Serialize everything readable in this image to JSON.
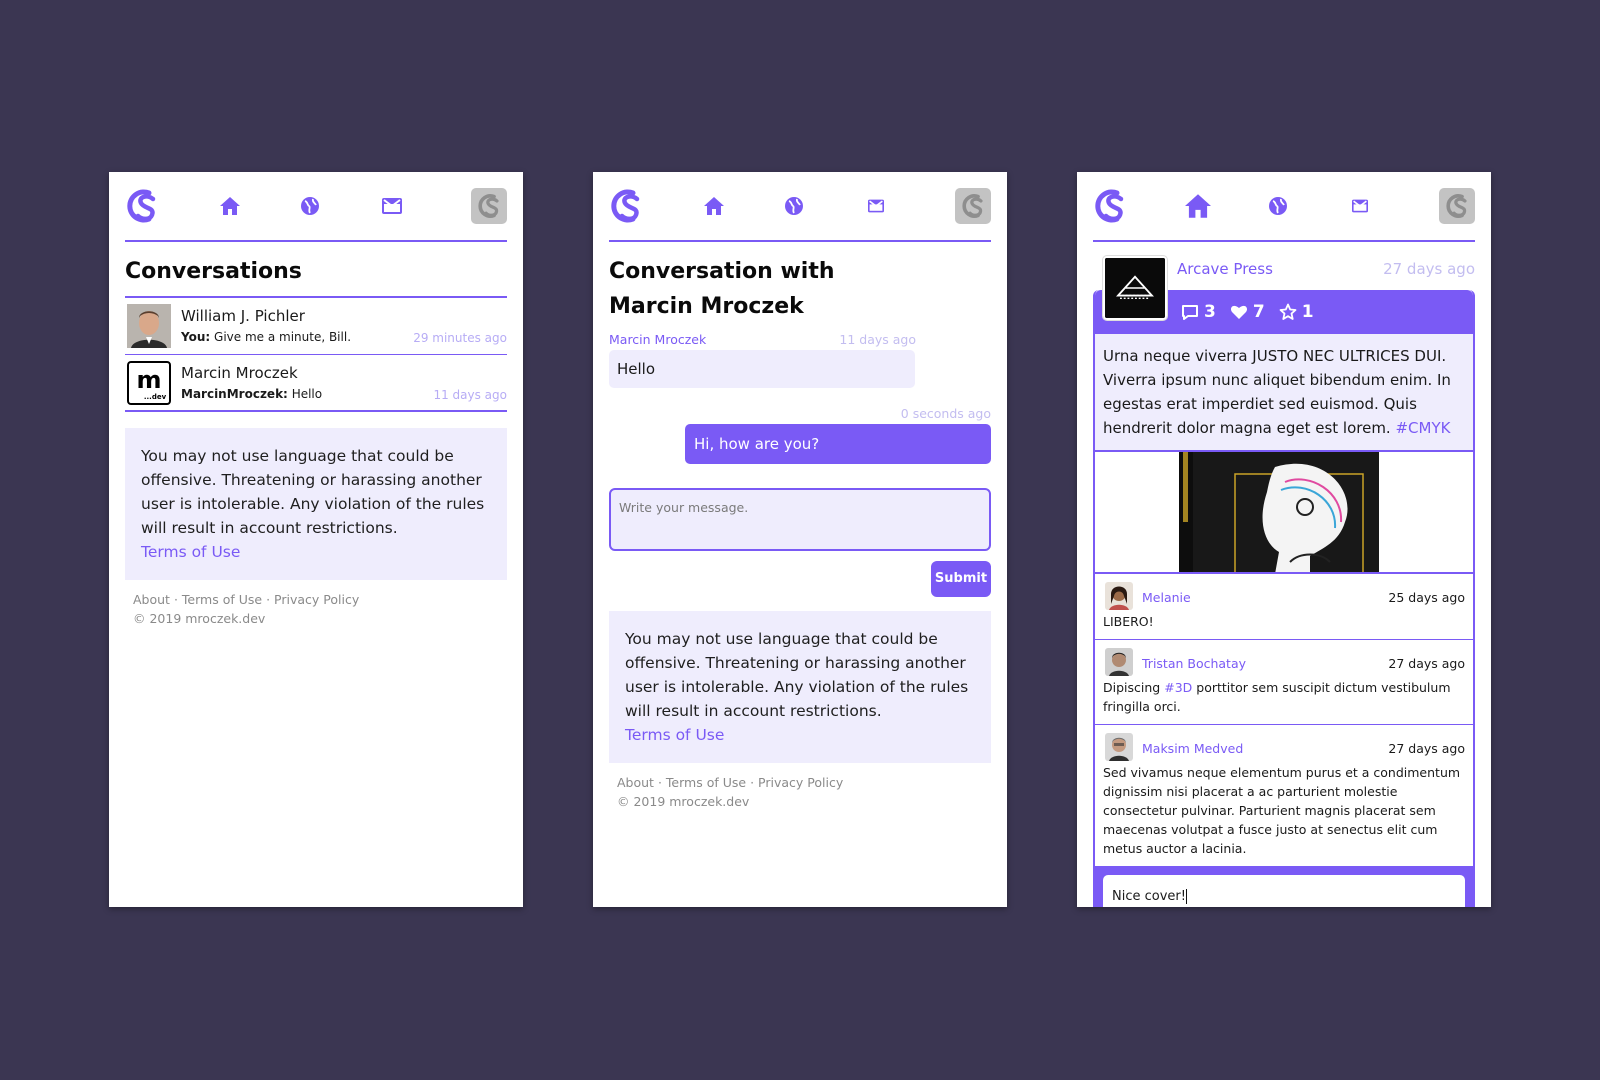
{
  "colors": {
    "background": "#3b3652",
    "accent": "#7a5af5",
    "accent_light": "#efedfd",
    "muted": "#c3bdf0"
  },
  "nav": {
    "icons": [
      "logo-icon",
      "home-icon",
      "globe-icon",
      "mail-icon",
      "profile-avatar-icon"
    ]
  },
  "conversations": {
    "title": "Conversations",
    "items": [
      {
        "name": "William J. Pichler",
        "sender": "You:",
        "preview": "Give me a minute, Bill.",
        "time": "29 minutes ago"
      },
      {
        "name": "Marcin Mroczek",
        "sender": "MarcinMroczek:",
        "preview": "Hello",
        "time": "11 days ago"
      }
    ]
  },
  "notice": {
    "text": "You may not use language that could be offensive. Threatening or harassing another user is intolerable. Any violation of the rules will result in account restrictions.",
    "link": "Terms of Use"
  },
  "footer": {
    "about": "About",
    "terms": "Terms of Use",
    "privacy": "Privacy Policy",
    "sep": "·",
    "copyright": "© 2019 mroczek.dev"
  },
  "chat": {
    "title_line1": "Conversation with",
    "title_line2": "Marcin Mroczek",
    "incoming": {
      "sender": "Marcin Mroczek",
      "time": "11 days ago",
      "text": "Hello"
    },
    "outgoing": {
      "time": "0 seconds ago",
      "text": "Hi, how are you?"
    },
    "compose_placeholder": "Write your message.",
    "submit_label": "Submit"
  },
  "post": {
    "author": "Arcave Press",
    "time": "27 days ago",
    "comments_count": "3",
    "likes_count": "7",
    "stars_count": "1",
    "body": "Urna neque viverra JUSTO NEC ULTRICES DUI. Viverra ipsum nunc aliquet bibendum enim. In egestas erat imperdiet sed euismod. Quis hendrerit dolor magna eget est lorem.",
    "hashtag": "#CMYK",
    "comments": [
      {
        "name": "Melanie",
        "time": "25 days ago",
        "text": "LIBERO!"
      },
      {
        "name": "Tristan Bochatay",
        "time": "27 days ago",
        "text_before": "Dipiscing",
        "tag": "#3D",
        "text_after": "porttitor sem suscipit dictum vestibulum fringilla orci."
      },
      {
        "name": "Maksim Medved",
        "time": "27 days ago",
        "text": "Sed vivamus neque elementum purus et a condimentum dignissim nisi placerat a ac parturient molestie consectetur pulvinar. Parturient magnis placerat sem maecenas volutpat a fusce justo at senectus elit cum metus auctor a lacinia."
      }
    ],
    "reply_value": "Nice cover!"
  }
}
